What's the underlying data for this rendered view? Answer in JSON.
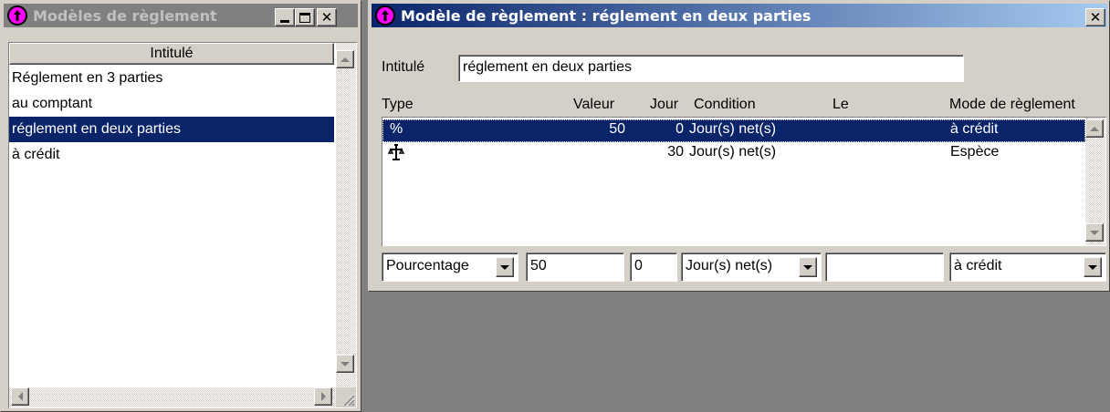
{
  "colors": {
    "desktop": "#808080",
    "face": "#d4d0c8",
    "selection": "#0a246a",
    "active_title_start": "#0a246a",
    "active_title_end": "#a6caf0",
    "inactive_title": "#808080",
    "app_icon": "#ff00ff"
  },
  "list_window": {
    "title": "Modèles de règlement",
    "icon": "app-logo-icon",
    "column_header": "Intitulé",
    "items": [
      {
        "label": "Réglement en 3 parties",
        "selected": false
      },
      {
        "label": "au comptant",
        "selected": false
      },
      {
        "label": "réglement en deux parties",
        "selected": true
      },
      {
        "label": "à crédit",
        "selected": false
      }
    ]
  },
  "detail_window": {
    "title": "Modèle de règlement : réglement en deux parties",
    "icon": "app-logo-icon",
    "intitule_label": "Intitulé",
    "intitule_value": "réglement en deux parties",
    "columns": {
      "type": "Type",
      "valeur": "Valeur",
      "jour": "Jour",
      "condition": "Condition",
      "le": "Le",
      "mode": "Mode de règlement"
    },
    "rows": [
      {
        "type": "%",
        "type_icon": "percent-icon",
        "valeur": "50",
        "jour": "0",
        "condition": "Jour(s) net(s)",
        "le": "",
        "mode": "à crédit",
        "selected": true
      },
      {
        "type": "",
        "type_icon": "balance-icon",
        "valeur": "",
        "jour": "30",
        "condition": "Jour(s) net(s)",
        "le": "",
        "mode": "Espèce",
        "selected": false
      }
    ],
    "editor": {
      "type": "Pourcentage",
      "valeur": "50",
      "jour": "0",
      "condition": "Jour(s) net(s)",
      "le": "",
      "mode": "à crédit"
    }
  }
}
